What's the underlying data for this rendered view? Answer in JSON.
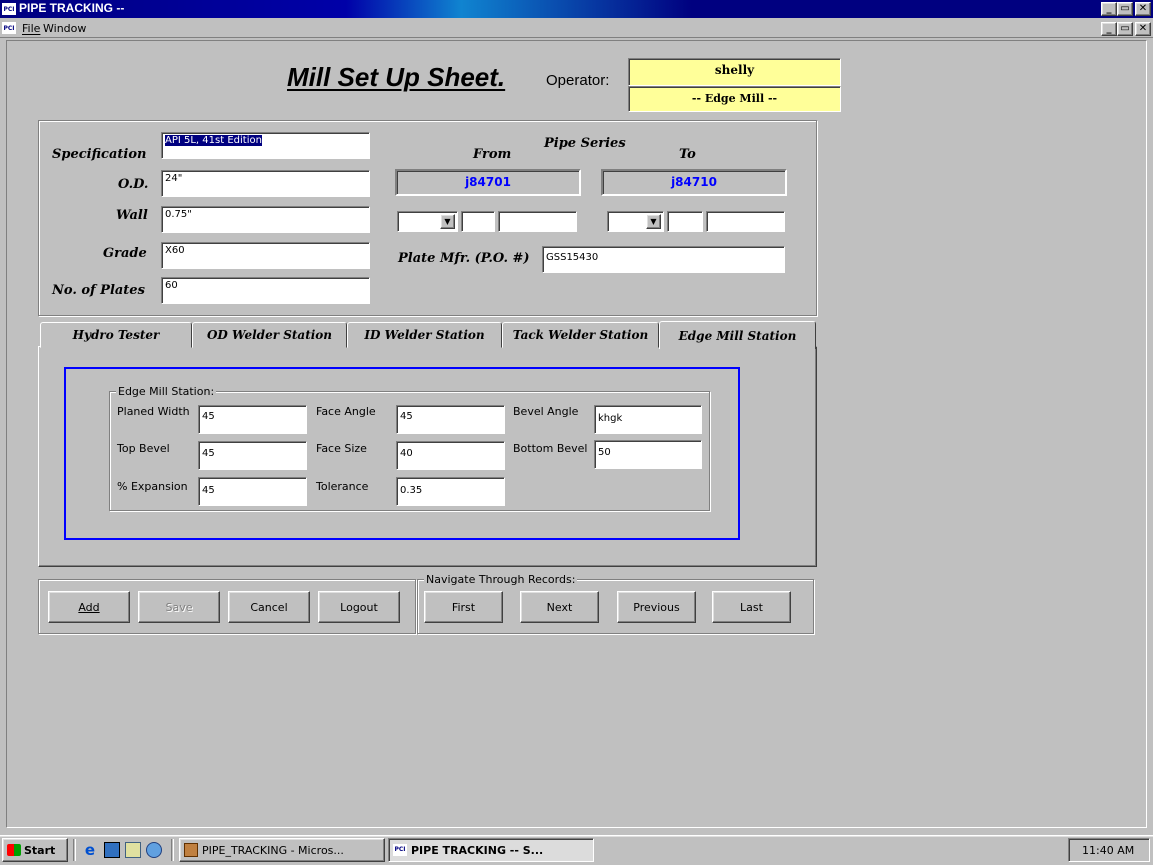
{
  "window": {
    "title": "PIPE TRACKING --",
    "app_icon": "PCI"
  },
  "menubar": {
    "items": [
      "File",
      "Window"
    ]
  },
  "sheet": {
    "title": "Mill Set Up Sheet.",
    "operator_label": "Operator:",
    "operator_value": "shelly",
    "station_value": "-- Edge Mill --"
  },
  "spec": {
    "specification_label": "Specification",
    "specification_value": "API 5L, 41st Edition",
    "od_label": "O.D.",
    "od_value": "24\"",
    "wall_label": "Wall",
    "wall_value": "0.75\"",
    "grade_label": "Grade",
    "grade_value": "X60",
    "plates_label": "No. of Plates",
    "plates_value": "60"
  },
  "pipe_series": {
    "header": "Pipe Series",
    "from_label": "From",
    "to_label": "To",
    "from_value": "j84701",
    "to_value": "j84710",
    "plate_mfr_label": "Plate Mfr. (P.O. #)",
    "plate_mfr_value": "GSS15430"
  },
  "tabs": [
    {
      "label": "Hydro Tester"
    },
    {
      "label": "OD Welder Station"
    },
    {
      "label": "ID Welder Station"
    },
    {
      "label": "Tack Welder Station"
    },
    {
      "label": "Edge Mill Station"
    }
  ],
  "edge_mill": {
    "group_label": "Edge Mill Station:",
    "planed_width_label": "Planed Width",
    "planed_width_value": "45",
    "face_angle_label": "Face Angle",
    "face_angle_value": "45",
    "bevel_angle_label": "Bevel Angle",
    "bevel_angle_value": "khgk",
    "top_bevel_label": "Top Bevel",
    "top_bevel_value": "45",
    "face_size_label": "Face Size",
    "face_size_value": "40",
    "bottom_bevel_label": "Bottom Bevel",
    "bottom_bevel_value": "50",
    "expansion_label": "% Expansion",
    "expansion_value": "45",
    "tolerance_label": "Tolerance",
    "tolerance_value": "0.35"
  },
  "actions": {
    "add": "Add",
    "save": "Save",
    "cancel": "Cancel",
    "logout": "Logout"
  },
  "navigate": {
    "group_label": "Navigate Through Records:",
    "first": "First",
    "next": "Next",
    "previous": "Previous",
    "last": "Last"
  },
  "taskbar": {
    "start": "Start",
    "items": [
      "PIPE_TRACKING - Micros...",
      "PIPE TRACKING -- S..."
    ],
    "clock": "11:40 AM"
  },
  "colors": {
    "title_bar": "#000080",
    "accent_blue": "#0000ff",
    "highlight_yellow": "#ffff99",
    "series_text": "#0000ff"
  }
}
